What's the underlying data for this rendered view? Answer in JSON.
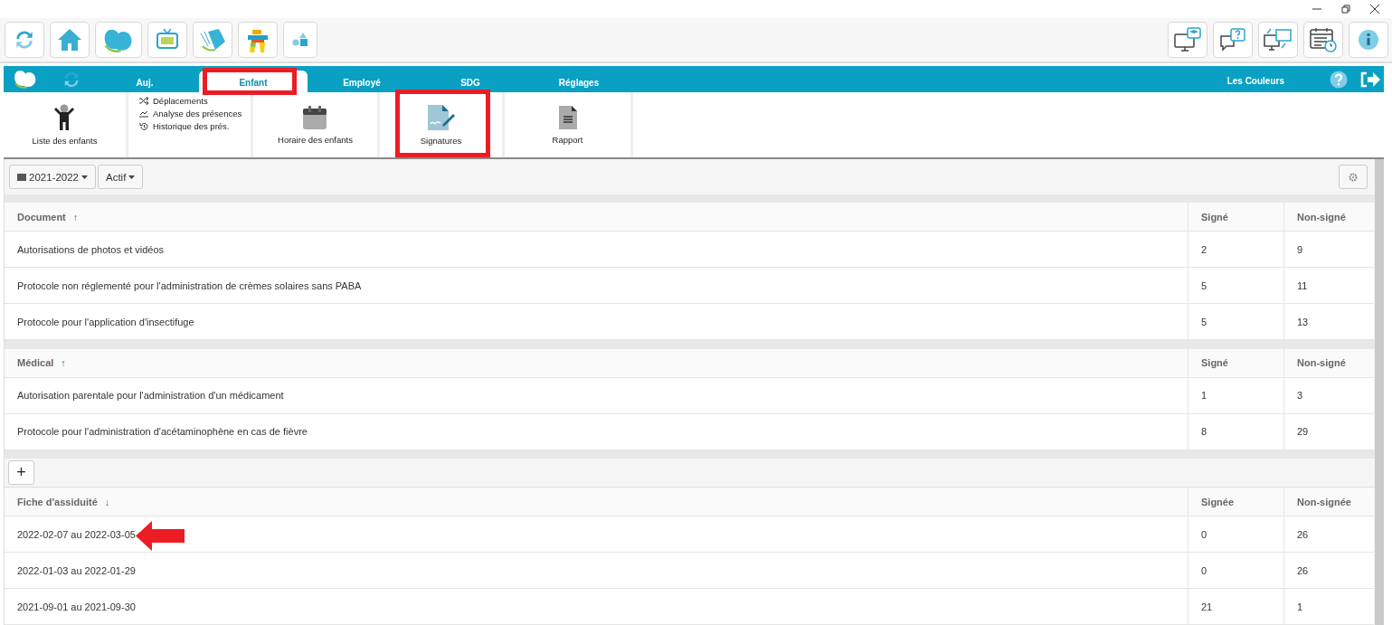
{
  "nav": {
    "tabs": [
      {
        "label": "Auj.",
        "selected": false,
        "annotated": false
      },
      {
        "label": "Enfant",
        "selected": true,
        "annotated": true
      },
      {
        "label": "Employé",
        "selected": false,
        "annotated": false
      },
      {
        "label": "SDG",
        "selected": false,
        "annotated": false
      },
      {
        "label": "Réglages",
        "selected": false,
        "annotated": false
      }
    ],
    "account": "Les Couleurs"
  },
  "ribbon": [
    {
      "kind": "big",
      "label": "Liste des enfants",
      "annotated": false
    },
    {
      "kind": "links",
      "links": [
        {
          "label": "Déplacements"
        },
        {
          "label": "Analyse des présences"
        },
        {
          "label": "Historique des prés."
        }
      ]
    },
    {
      "kind": "big",
      "label": "Horaire des enfants",
      "annotated": false
    },
    {
      "kind": "big",
      "label": "Signatures",
      "annotated": true
    },
    {
      "kind": "big",
      "label": "Rapport",
      "annotated": false
    }
  ],
  "filters": {
    "year": "2021-2022",
    "status": "Actif"
  },
  "sections": [
    {
      "kind": "table",
      "columns": [
        {
          "label": "Document",
          "sort_mark": "↑"
        },
        {
          "label": "Signé"
        },
        {
          "label": "Non-signé"
        }
      ],
      "rows": [
        {
          "cells": [
            "Autorisations de photos et vidéos",
            "2",
            "9"
          ],
          "annotated": false
        },
        {
          "cells": [
            "Protocole non réglementé pour l'administration de crèmes solaires sans PABA",
            "5",
            "11"
          ],
          "annotated": false
        },
        {
          "cells": [
            "Protocole pour l'application d'insectifuge",
            "5",
            "13"
          ],
          "annotated": false
        }
      ]
    },
    {
      "kind": "table",
      "columns": [
        {
          "label": "Médical",
          "sort_mark": "↑"
        },
        {
          "label": "Signé"
        },
        {
          "label": "Non-signé"
        }
      ],
      "rows": [
        {
          "cells": [
            "Autorisation parentale pour l'administration d'un médicament",
            "1",
            "3"
          ],
          "annotated": false
        },
        {
          "cells": [
            "Protocole pour l'administration d'acétaminophène en cas de fièvre",
            "8",
            "29"
          ],
          "annotated": false
        }
      ]
    },
    {
      "kind": "add-table",
      "add_label": "+",
      "columns": [
        {
          "label": "Fiche d'assiduité",
          "sort_mark": "↓"
        },
        {
          "label": "Signée"
        },
        {
          "label": "Non-signée"
        }
      ],
      "rows": [
        {
          "cells": [
            "2022-02-07 au 2022-03-05",
            "0",
            "26"
          ],
          "annotated": true
        },
        {
          "cells": [
            "2022-01-03 au 2022-01-29",
            "0",
            "26"
          ],
          "annotated": false
        },
        {
          "cells": [
            "2021-09-01 au 2021-09-30",
            "21",
            "1"
          ],
          "annotated": false
        }
      ]
    }
  ]
}
